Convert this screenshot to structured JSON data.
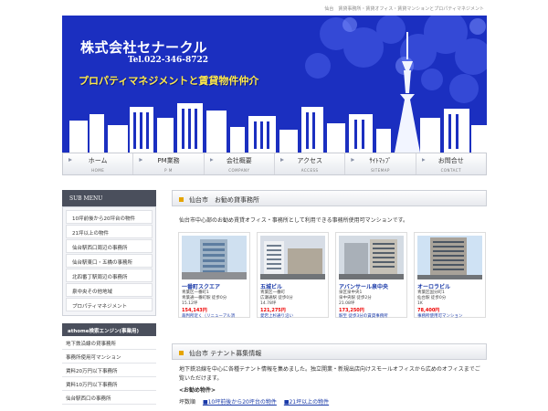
{
  "topbar": {
    "text": "仙台　賃貸事務所・賃貸オフィス・賃貸マンションとプロパティマネジメント"
  },
  "header": {
    "company": "株式会社セナークル",
    "tel": "Tel.022-346-8722",
    "tagline": "プロパティマネジメントと賃貸物件仲介"
  },
  "nav": [
    {
      "jp": "ホーム",
      "en": "HOME"
    },
    {
      "jp": "PM業務",
      "en": "P M"
    },
    {
      "jp": "会社概要",
      "en": "COMPANY"
    },
    {
      "jp": "アクセス",
      "en": "ACCESS"
    },
    {
      "jp": "ｻｲﾄﾏｯﾌﾟ",
      "en": "SITEMAP"
    },
    {
      "jp": "お問合せ",
      "en": "CONTACT"
    }
  ],
  "sidebar": {
    "submenu_title": "SUB MENU",
    "items": [
      "10坪前後から20坪台の物件",
      "21坪以上の物件",
      "仙台駅西口周辺の事務所",
      "仙台駅東口・五橋の事務所",
      "北四番丁駅周辺の事務所",
      "泉中央その他地域",
      "プロパティマネジメント"
    ],
    "athome_title": "athome検索エンジン(事業用)",
    "athome_items": [
      "地下鉄沿線の貸事務所",
      "事務所使用可マンション",
      "賃料20万円以下事務所",
      "賃料10万円以下事務所",
      "仙台駅西口の事務所"
    ]
  },
  "section1": {
    "title": "仙台市　お勧め貸事務所",
    "intro": "仙台市中心部のお勧め賃貸オフィス・事務所として利用できる事務所使用可マンションです。",
    "cards": [
      {
        "name": "一番町スクエア",
        "l1": "青葉区一番町1",
        "l2": "青葉通一番町駅 徒歩0分",
        "l3": "15.12坪",
        "price": "154,143円",
        "link": "裁判所近く（リニューアル済"
      },
      {
        "name": "五城ビル",
        "l1": "青葉区一番町",
        "l2": "広瀬通駅 徒歩0分",
        "l3": "14.78坪",
        "price": "121,275円",
        "link": "愛宕上杉通り沿い"
      },
      {
        "name": "アバンサール泉中央",
        "l1": "泉区泉中央1",
        "l2": "泉中央駅 徒歩2分",
        "l3": "21.08坪",
        "price": "173,250円",
        "link": "駅至 徒歩3分の賃貸事務所"
      },
      {
        "name": "オーロラビル",
        "l1": "青葉区国分町1",
        "l2": "仙台駅 徒歩0分",
        "l3": "1K",
        "price": "78,400円",
        "link": "事務所使用可マンション"
      }
    ]
  },
  "section2": {
    "title": "仙台市 テナント募集情報",
    "text": "地下鉄沿線を中心に各種テナント情報を集めました。独立開業・新規出店向けスモールオフィスから広めのオフィスまでご覧いただけます。",
    "recommend": "<お勧め物件>",
    "label": "坪数順",
    "link1": "■10坪前後から20坪台の物件",
    "link2": "■21坪以上の物件"
  },
  "colors": {
    "hero_blue": "#1b2fc0",
    "tagline_yellow": "#ffe94a",
    "price_red": "#e00000",
    "link_blue": "#1a3aa8",
    "accent_orange": "#e5a400"
  }
}
